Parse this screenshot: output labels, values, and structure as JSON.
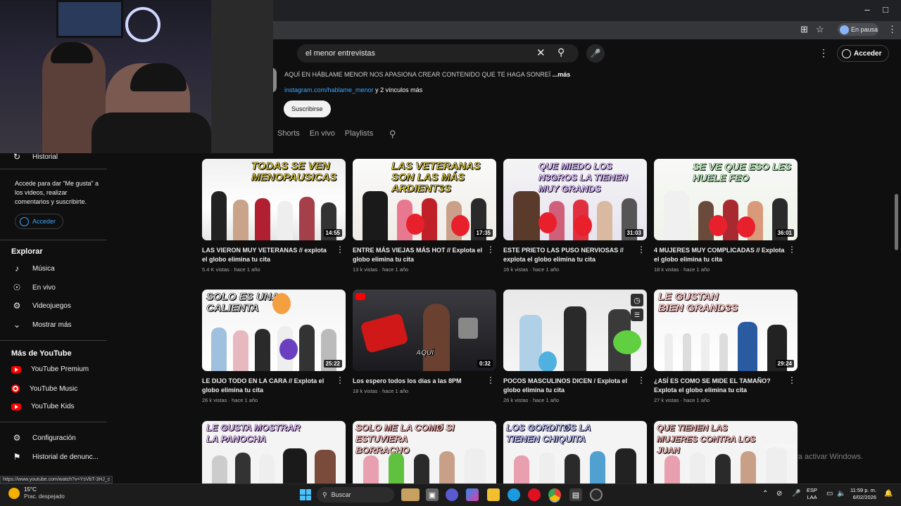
{
  "browser": {
    "profile_label": "En pausa",
    "status_url": "https://www.youtube.com/watch?v=YsVbT-3HJ_c"
  },
  "youtube": {
    "search_value": "el menor entrevistas",
    "signin_label": "Acceder",
    "channel_description": "AQUÍ EN HÁBLAME MENOR NOS APASIONA CREAR CONTENIDO QUE TE HAGA SONREÍ",
    "more_label": "...más",
    "link_text": "instagram.com/hablame_menor",
    "link_suffix": "y 2 vínculos más",
    "subscribe_label": "Suscribirse",
    "tabs": [
      "Shorts",
      "En vivo",
      "Playlists"
    ]
  },
  "sidebar": {
    "history": "Historial",
    "signin_note": "Accede para dar “Me gusta” a los videos, realizar comentarios y suscribirte.",
    "signin_button": "Acceder",
    "explore_heading": "Explorar",
    "explore_items": [
      "Música",
      "En vivo",
      "Videojuegos",
      "Mostrar más"
    ],
    "more_heading": "Más de YouTube",
    "more_items": [
      "YouTube Premium",
      "YouTube Music",
      "YouTube Kids"
    ],
    "settings": "Configuración",
    "report_history": "Historial de denunc..."
  },
  "videos": [
    {
      "thumb_text": "TODAS SE VEN MENOPAUSICAS",
      "duration": "14:55",
      "title": "LAS VIERON MUY VETERANAS // explota el globo elimina tu cita",
      "views": "5.4 K vistas",
      "age": "hace 1 año"
    },
    {
      "thumb_text": "LAS VETERANAS SON LAS MÁS ARDIENT3S",
      "duration": "17:35",
      "title": "ENTRE MÁS VIEJAS MÁS HOT // Explota el globo elimina tu cita",
      "views": "13 k vistas",
      "age": "hace 1 año"
    },
    {
      "thumb_text": "QUE MIEDO LOS N3GROS LA TIENEN MUY GRANDS",
      "duration": "31:03",
      "title": "ESTE PRIETO LAS PUSO NERVIOSAS // explota el globo elimina tu cita",
      "views": "16 k vistas",
      "age": "hace 1 año"
    },
    {
      "thumb_text": "SE VE QUE ESO LES HUELE FEO",
      "duration": "36:01",
      "title": "4 MUJERES MUY COMPLICADAS // Explota el globo elimina tu cita",
      "views": "18 k vistas",
      "age": "hace 1 año"
    },
    {
      "thumb_text": "SOLO ES UNA CALIENTA",
      "duration": "25:22",
      "title": "LE DIJO TODO EN LA CARA // Explota el globo elimina tu cita",
      "views": "26 k vistas",
      "age": "hace 1 año"
    },
    {
      "thumb_text": "AQUÍ",
      "duration": "0:32",
      "title": "Los espero todos los días a las 8PM",
      "views": "18 k vistas",
      "age": "hace 1 año"
    },
    {
      "thumb_text": "",
      "duration": "",
      "title": "POCOS MASCULINOS DICEN / Explota el globo elimina tu cita",
      "views": "26 k vistas",
      "age": "hace 1 año"
    },
    {
      "thumb_text": "LE GUSTAN BIEN GRAND3S",
      "duration": "29:24",
      "title": "¿ASÍ ES COMO SE MIDE EL TAMAÑO? Explota el globo elimina tu cita",
      "views": "27 k vistas",
      "age": "hace 1 año"
    },
    {
      "thumb_text": "LE GUSTA MOSTRAR LA PANOCHA"
    },
    {
      "thumb_text": "SOLO ME LA COMØ SI ESTUVIERA BORRACHO"
    },
    {
      "thumb_text": "LOS GORDITØS LA TIENEN CHIQUITA"
    },
    {
      "thumb_text": "QUE TIENEN LAS MUJERES CONTRA LOS JUAN"
    }
  ],
  "windows": {
    "watermark_line1": "Windows",
    "watermark_line2": "ara activar Windows.",
    "temperature": "15°C",
    "weather": "Prac. despejado",
    "search_label": "Buscar",
    "lang_line1": "ESP",
    "lang_line2": "LAA",
    "time": "11:59 p. m.",
    "date": "6/02/2026"
  }
}
